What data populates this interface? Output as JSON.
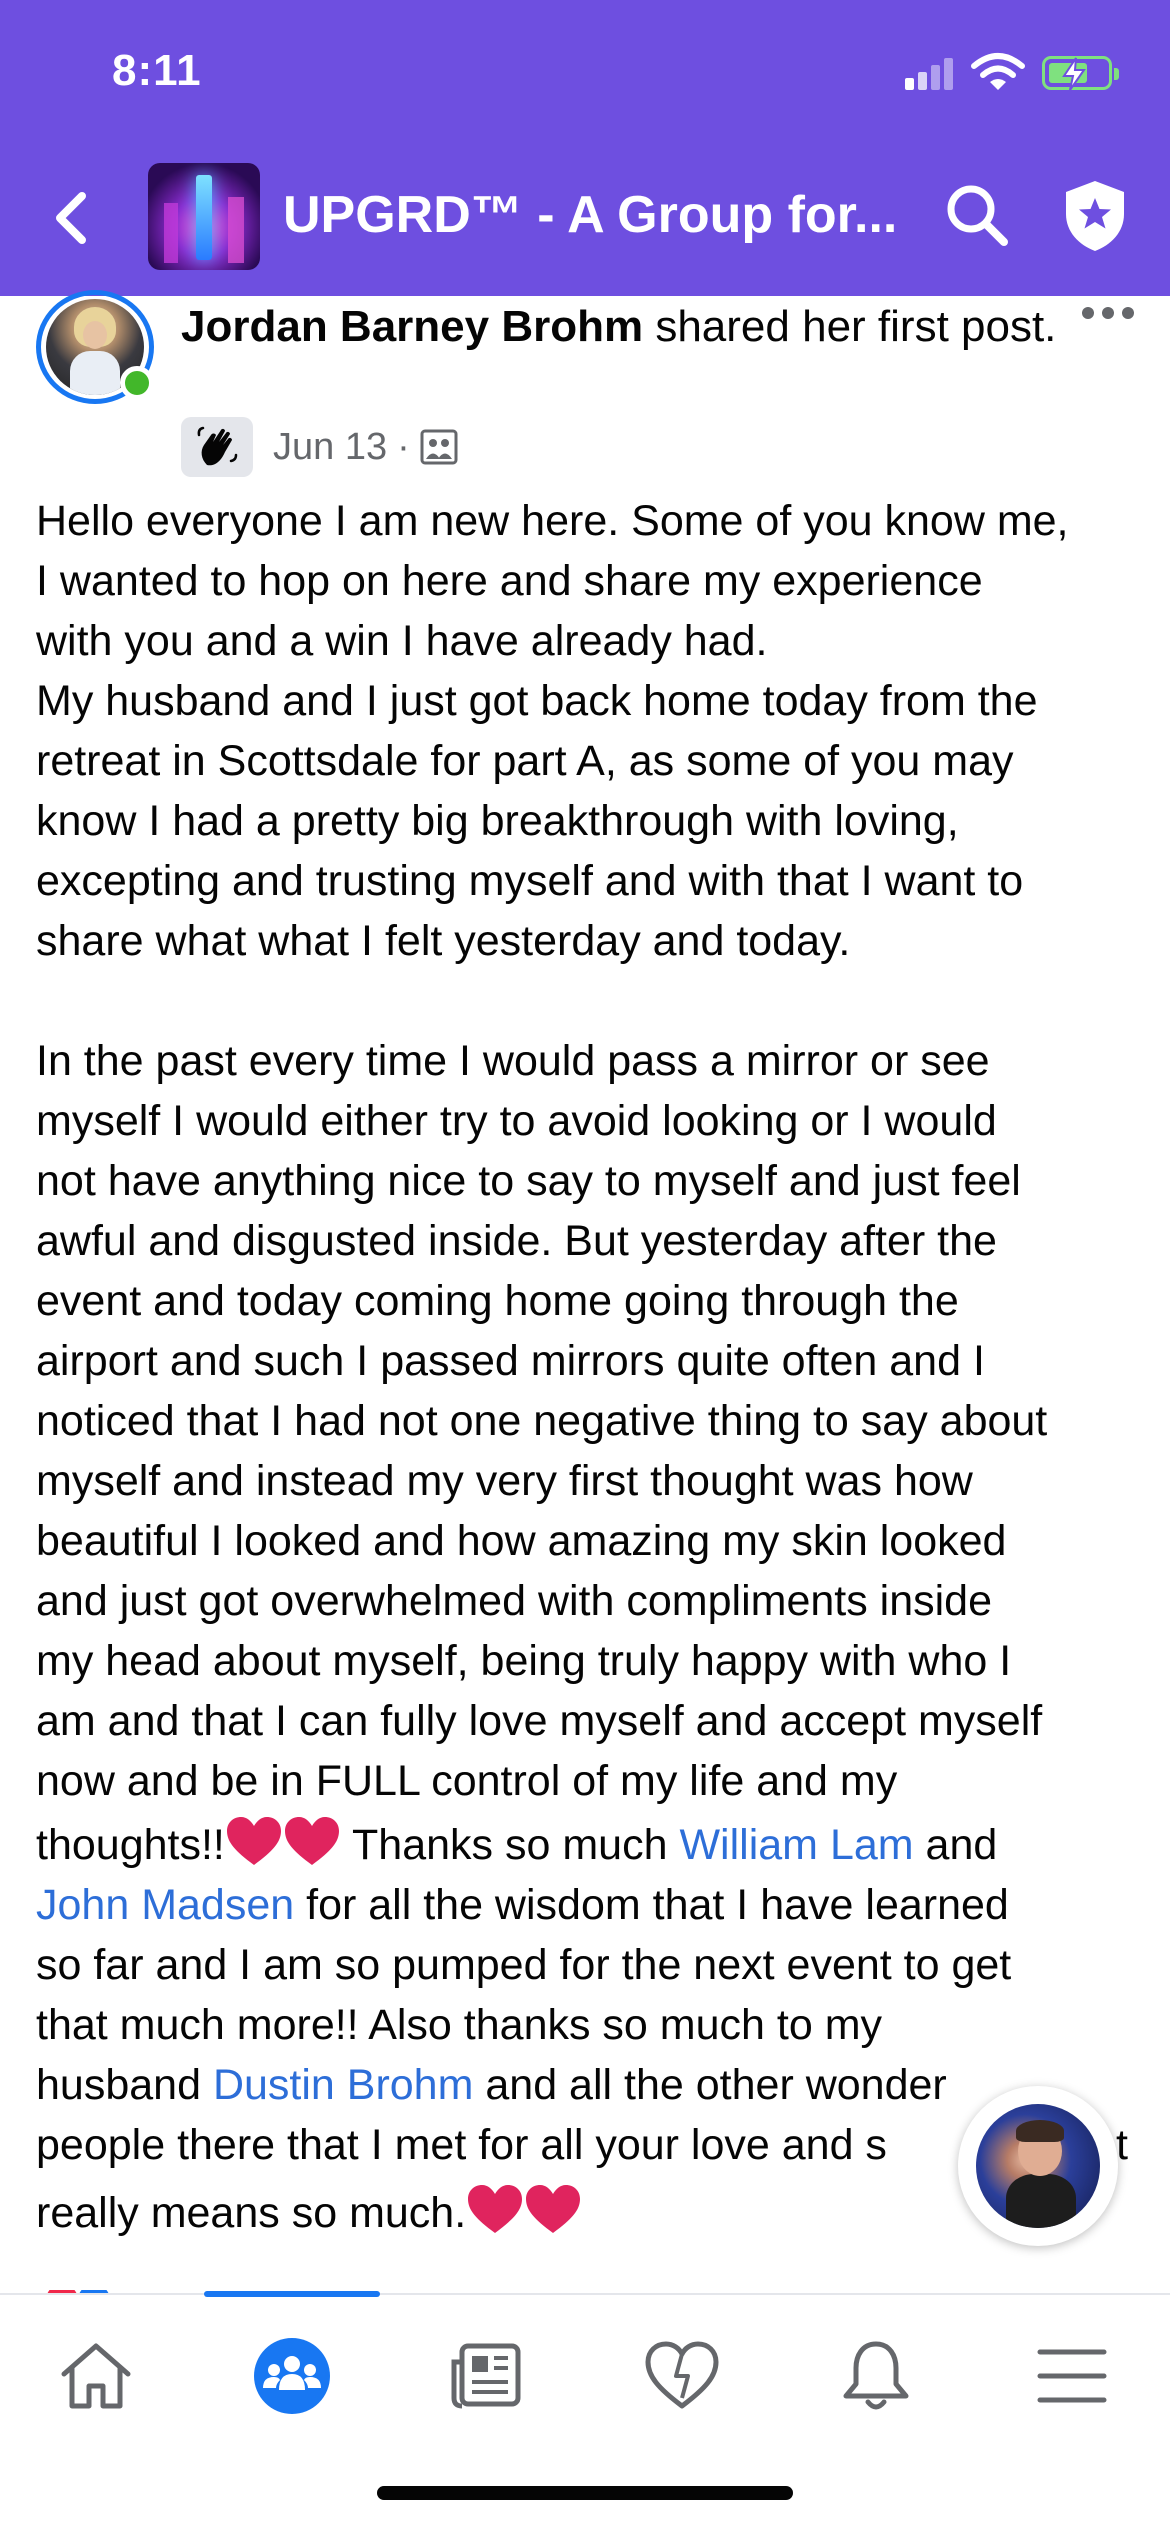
{
  "status_bar": {
    "time": "8:11",
    "battery_color": "#7fe17f"
  },
  "header": {
    "background": "#6e4fe0",
    "group_title": "UPGRD™ - A Group for...",
    "back_icon": "chevron-left-icon",
    "search_icon": "search-icon",
    "admin_icon": "shield-star-icon"
  },
  "post": {
    "author": "Jordan Barney Brohm",
    "action_text": " shared her first post.",
    "date": "Jun 13",
    "meta_separator": "·",
    "privacy_icon": "members-icon",
    "badge_icon": "waving-hand-icon",
    "mention_color": "#2d6ed8",
    "paragraphs": {
      "p1_l1": "Hello everyone I am new here. Some of you know me,",
      "p1_l2": "I wanted to hop on here and share my experience",
      "p1_l3": "with you and a win I have already had.",
      "p1_l4": "My husband and I just got back home today from the",
      "p1_l5": "retreat in Scottsdale for part A, as some of you may",
      "p1_l6": "know I had a pretty big breakthrough with loving,",
      "p1_l7": "excepting and trusting myself and with that I want to",
      "p1_l8": "share what what I felt yesterday and today.",
      "p2_l1": "In the past every time I would pass a mirror or see",
      "p2_l2": "myself I would either try to avoid looking or I would",
      "p2_l3": "not have anything nice to say to myself and just feel",
      "p2_l4": "awful and disgusted inside. But yesterday after the",
      "p2_l5": "event and today coming home going through the",
      "p2_l6": "airport and such I passed mirrors quite often and I",
      "p2_l7": "noticed that I had not one negative thing to say about",
      "p2_l8": "myself and instead my very first thought was how",
      "p2_l9": "beautiful I looked and how amazing my skin looked",
      "p2_l10": "and just got overwhelmed with compliments inside",
      "p2_l11": "my head about myself, being truly happy with who I",
      "p2_l12": "am and that I can fully love myself and accept myself",
      "p2_l13": "now and be in FULL control of my life and my",
      "p2_l14_a": "thoughts!!",
      "p2_l14_b": " Thanks so much ",
      "mention_1": "William Lam",
      "p2_l14_c": " and",
      "mention_2": "John Madsen",
      "p2_l15_b": " for all the wisdom that I have learned",
      "p2_l16": "so far and I am so pumped for the next event to get",
      "p2_l17": "that much more!! Also thanks so much to my",
      "p2_l18_a": "husband ",
      "mention_3": "Dustin Brohm",
      "p2_l18_b": " and all the other wonder",
      "p2_l19": "people there that I met for all your love and s",
      "p2_l19_end": "t",
      "p2_l20": "really means so much."
    },
    "emoji": "red-heart-icon",
    "heart_color": "#e0245e"
  },
  "tabbar": {
    "active_color": "#1877f2",
    "tabs": [
      {
        "icon": "home-icon",
        "active": false
      },
      {
        "icon": "groups-icon",
        "active": true
      },
      {
        "icon": "news-feed-icon",
        "active": false
      },
      {
        "icon": "dating-heart-icon",
        "active": false
      },
      {
        "icon": "bell-icon",
        "active": false
      },
      {
        "icon": "menu-icon",
        "active": false
      }
    ]
  }
}
